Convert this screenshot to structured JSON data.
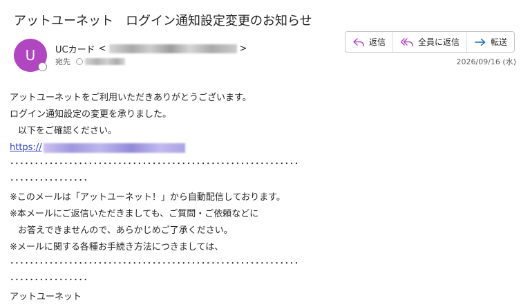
{
  "subject": "アットユーネット　ログイン通知設定変更のお知らせ",
  "sender": {
    "avatar_initial": "U",
    "name": "UCカード",
    "email_open": "<",
    "email_close": ">",
    "to_label": "宛先"
  },
  "actions": {
    "reply": "返信",
    "reply_all": "全員に返信",
    "forward": "転送"
  },
  "date": "2026/09/16 (水)",
  "body": {
    "line1": "アットユーネットをご利用いただきありがとうございます。",
    "line2": "ログイン通知設定の変更を承りました。",
    "line3": "以下をご確認ください。",
    "link_prefix": "https://",
    "dots1": "･･･････････････････････････････････････････････････････････ ･",
    "dots2": "････････････････",
    "notice1": "※このメールは「アットユーネット！」から自動配信しております。",
    "notice2": "※本メールにご返信いただきましても、ご質問・ご依頼などに",
    "notice3": "お答えできませんので、あらかじめご了承ください。",
    "notice4": "※メールに関する各種お手続き方法につきましては、",
    "dots3": "･････････････････････････････････････････････････････････････",
    "dots4": "････････････････",
    "signature": "アットユーネット"
  },
  "colors": {
    "avatar_bg": "#b146c2",
    "link": "#2b3cc4",
    "reply_icon": "#b146c2",
    "forward_icon": "#0f6cbd"
  }
}
